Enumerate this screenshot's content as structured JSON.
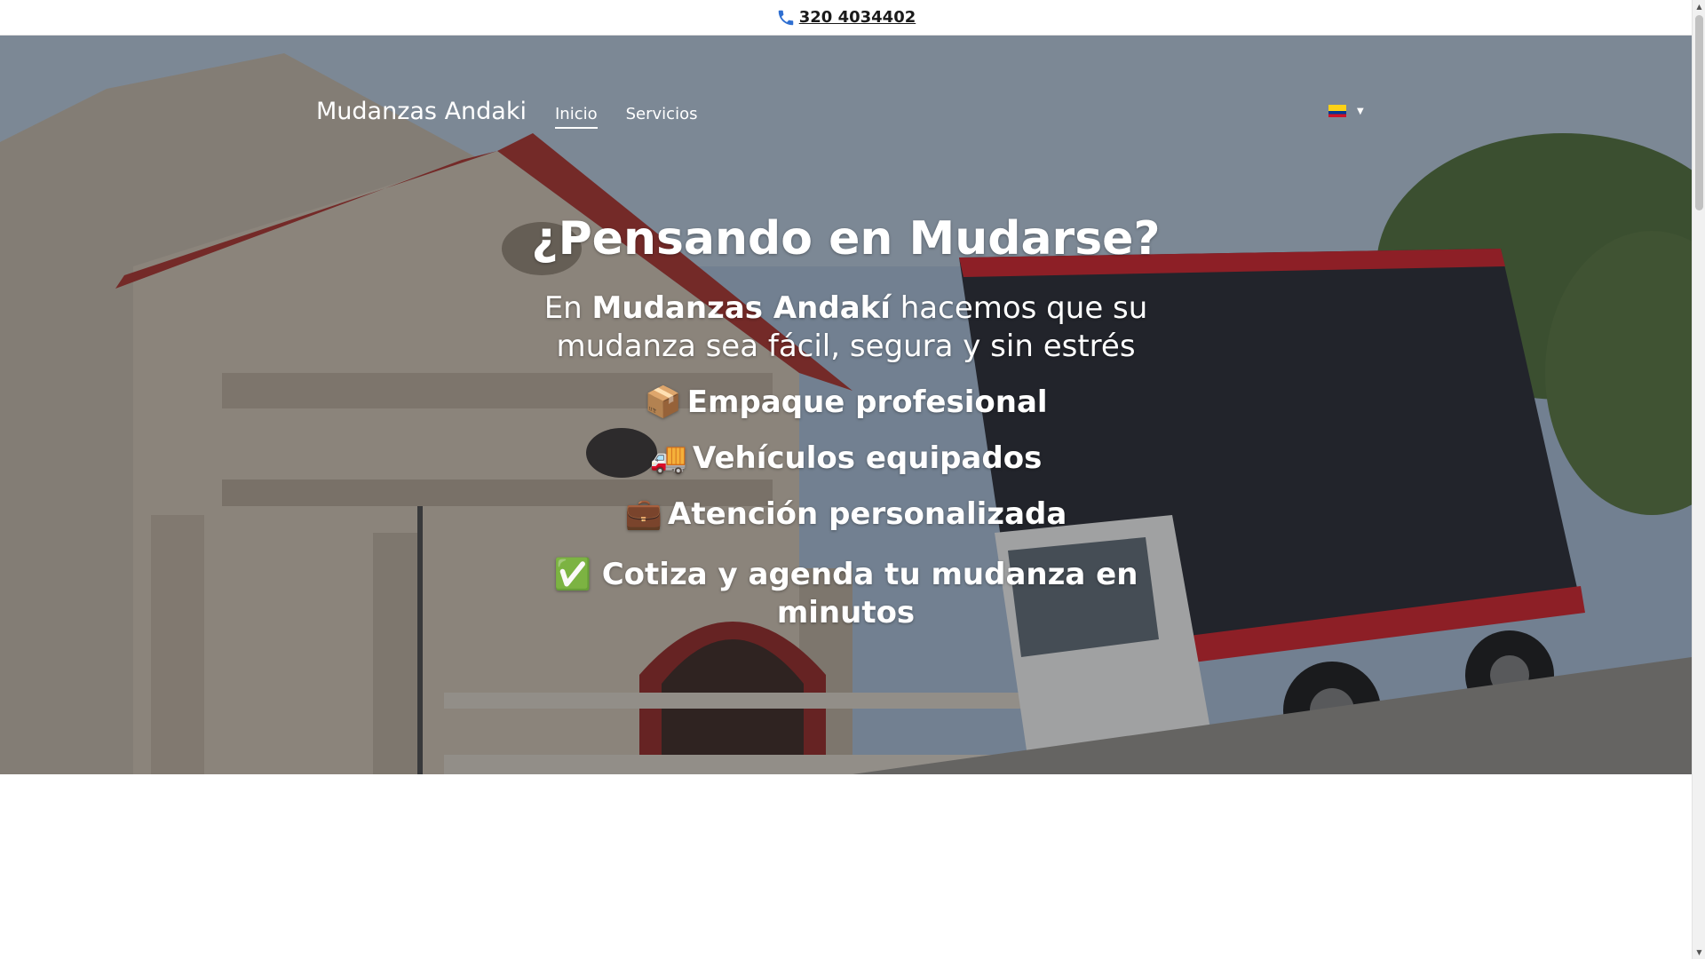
{
  "topbar": {
    "phone_icon": "phone-icon",
    "phone_text": "320 4034402"
  },
  "nav": {
    "brand": "Mudanzas Andaki",
    "links": [
      {
        "label": "Inicio",
        "active": true
      },
      {
        "label": "Servicios",
        "active": false
      }
    ],
    "language": {
      "flag": "colombia-flag-icon",
      "caret": "caret-down-icon"
    }
  },
  "hero": {
    "headline": "¿Pensando en Mudarse?",
    "lead_prefix": "En ",
    "lead_brand": "Mudanzas Andakí",
    "lead_suffix": " hacemos que su mudanza sea fácil, segura y sin estrés",
    "features": [
      {
        "emoji": "📦",
        "text": "Empaque profesional"
      },
      {
        "emoji": "🚚",
        "text": "Vehículos equipados"
      },
      {
        "emoji": "💼",
        "text": "Atención personalizada"
      }
    ],
    "cta_emoji": "✅",
    "cta_text": "Cotiza y agenda tu mudanza en minutos"
  },
  "colors": {
    "overlay": "#202228",
    "text": "#ffffff",
    "truck_box": "#2a2c33",
    "truck_trim": "#c8242b"
  }
}
